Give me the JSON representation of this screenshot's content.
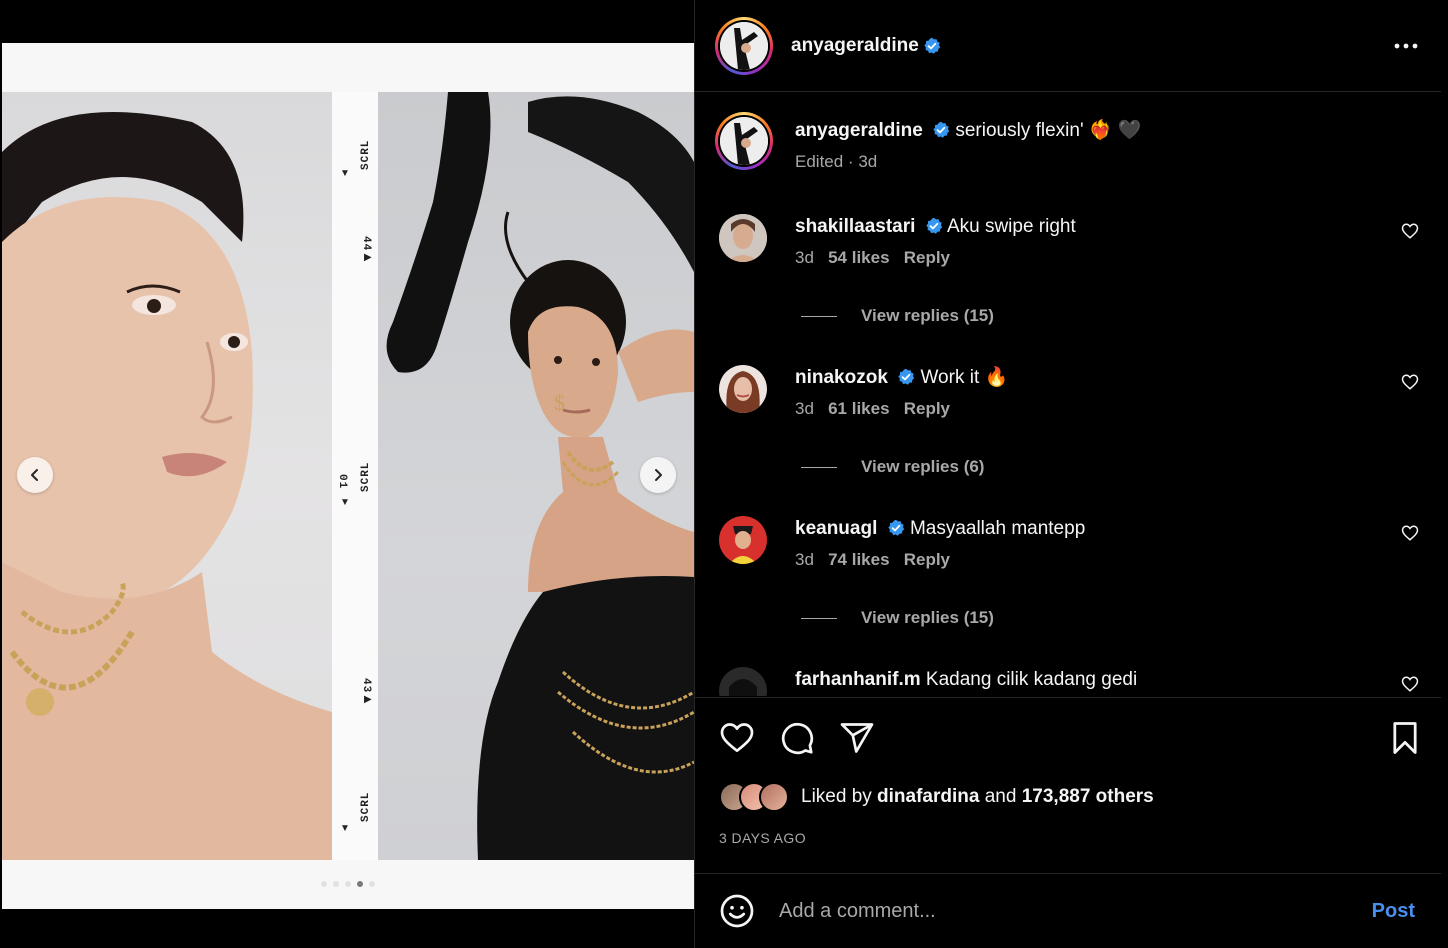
{
  "post": {
    "author": "anyageraldine",
    "more_icon": "more-horizontal-icon"
  },
  "caption": {
    "username": "anyageraldine",
    "text": "seriously flexin'",
    "emojis": "❤️‍🔥 🖤",
    "edited": "Edited",
    "separator": " · ",
    "age": "3d"
  },
  "comments": [
    {
      "username": "shakillaastari",
      "verified": true,
      "text": "Aku swipe right",
      "emoji": "",
      "age": "3d",
      "likes": "54 likes",
      "reply": "Reply",
      "view_replies": "View replies (15)",
      "avatar_color": "#b99a86"
    },
    {
      "username": "ninakozok",
      "verified": true,
      "text": "Work it",
      "emoji": "🔥",
      "age": "3d",
      "likes": "61 likes",
      "reply": "Reply",
      "view_replies": "View replies (6)",
      "avatar_color": "#a5614a"
    },
    {
      "username": "keanuagl",
      "verified": true,
      "text": "Masyaallah mantepp",
      "emoji": "",
      "age": "3d",
      "likes": "74 likes",
      "reply": "Reply",
      "view_replies": "View replies (15)",
      "avatar_color": "#d8302c"
    },
    {
      "username": "farhanhanif.m",
      "verified": false,
      "text": "Kadang cilik kadang gedi",
      "emoji": "",
      "avatar_color": "#2a2a2a"
    }
  ],
  "likes": {
    "prefix": "Liked by ",
    "liker": "dinafardina",
    "middle": " and ",
    "count": "173,887 others"
  },
  "time_ago": "3 DAYS AGO",
  "comment_box": {
    "placeholder": "Add a comment...",
    "post_label": "Post"
  },
  "media": {
    "strip_labels": [
      "SCRL",
      "44",
      "01",
      "SCRL",
      "43",
      "SCRL"
    ],
    "dots_total": 5,
    "dots_active_index": 3
  },
  "colors": {
    "background": "#000000",
    "text": "#f5f5f5",
    "muted": "#a8a8a8",
    "divider": "#262626",
    "link": "#4a8ff0",
    "verified": "#3797f0"
  }
}
